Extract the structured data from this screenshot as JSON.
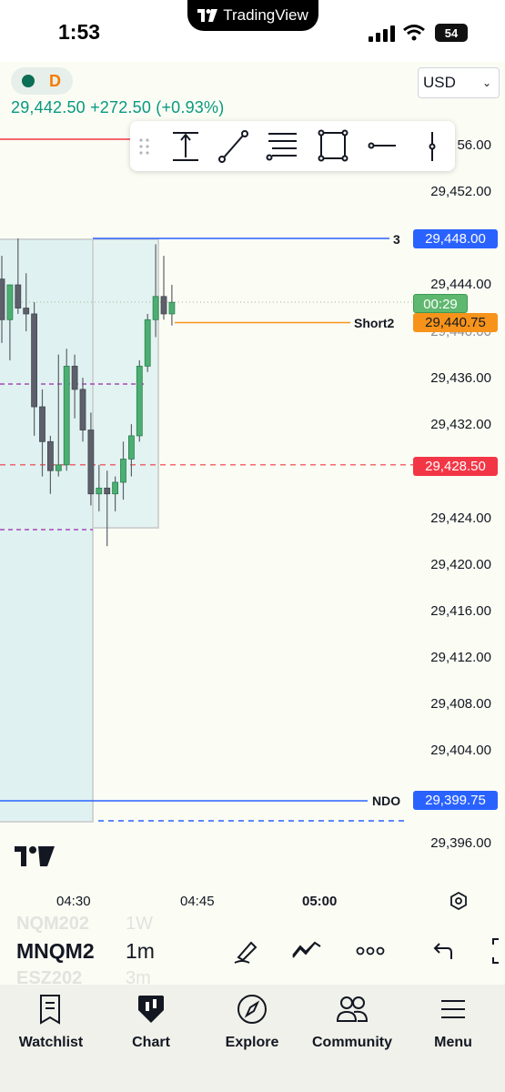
{
  "status": {
    "time": "1:53",
    "island_brand": "TradingView",
    "battery": "54"
  },
  "symbol": {
    "interval_badge": "D",
    "price_line": "29,442.50 +272.50 (+0.93%)"
  },
  "currency": "USD",
  "price_axis": [
    "56.00",
    "29,452.00",
    "29,448.00",
    "29,444.00",
    "29,440.00",
    "29,436.00",
    "29,432.00",
    "29,428.00",
    "29,424.00",
    "29,420.00",
    "29,416.00",
    "29,412.00",
    "29,408.00",
    "29,404.00",
    "29,400.00",
    "29,396.00"
  ],
  "tags": {
    "line3": {
      "label": "3",
      "price": "29,448.00",
      "color": "#2962ff"
    },
    "countdown": {
      "label": "00:29",
      "color": "#5fb86f"
    },
    "short2": {
      "label": "Short2",
      "price": "29,440.75",
      "color": "#f7931a"
    },
    "red": {
      "price": "29,428.50",
      "color": "#f23645"
    },
    "ndo": {
      "label": "NDO",
      "price": "29,399.75",
      "color": "#2962ff"
    }
  },
  "time_axis": [
    "04:30",
    "04:45",
    "05:00"
  ],
  "bottom": {
    "symbol_prev": "NQM202",
    "symbol": "MNQM2",
    "symbol_next": "ESZ202",
    "interval_prev": "1W",
    "interval": "1m",
    "interval_next": "3m"
  },
  "tabs": [
    "Watchlist",
    "Chart",
    "Explore",
    "Community",
    "Menu"
  ],
  "colors": {
    "up": "#4caf72",
    "down": "#5d606b",
    "green_text": "#089981"
  },
  "candles": [
    {
      "o": 29444.5,
      "h": 29446.5,
      "l": 29439.0,
      "c": 29441.0
    },
    {
      "o": 29441.0,
      "h": 29444.0,
      "l": 29437.5,
      "c": 29444.0
    },
    {
      "o": 29444.0,
      "h": 29448.0,
      "l": 29441.5,
      "c": 29442.0
    },
    {
      "o": 29442.0,
      "h": 29445.0,
      "l": 29440.0,
      "c": 29441.5
    },
    {
      "o": 29441.5,
      "h": 29442.5,
      "l": 29431.0,
      "c": 29433.5
    },
    {
      "o": 29433.5,
      "h": 29435.0,
      "l": 29427.5,
      "c": 29430.5
    },
    {
      "o": 29430.5,
      "h": 29431.0,
      "l": 29426.0,
      "c": 29428.0
    },
    {
      "o": 29428.0,
      "h": 29438.0,
      "l": 29427.5,
      "c": 29428.5
    },
    {
      "o": 29428.5,
      "h": 29438.5,
      "l": 29428.0,
      "c": 29437.0
    },
    {
      "o": 29437.0,
      "h": 29438.0,
      "l": 29432.5,
      "c": 29435.0
    },
    {
      "o": 29435.0,
      "h": 29436.0,
      "l": 29430.5,
      "c": 29431.5
    },
    {
      "o": 29431.5,
      "h": 29433.0,
      "l": 29425.0,
      "c": 29426.0
    },
    {
      "o": 29426.0,
      "h": 29428.5,
      "l": 29424.5,
      "c": 29426.5
    },
    {
      "o": 29426.5,
      "h": 29428.0,
      "l": 29421.5,
      "c": 29426.0
    },
    {
      "o": 29426.0,
      "h": 29427.5,
      "l": 29424.5,
      "c": 29427.0
    },
    {
      "o": 29427.0,
      "h": 29430.5,
      "l": 29425.5,
      "c": 29429.0
    },
    {
      "o": 29429.0,
      "h": 29432.0,
      "l": 29427.5,
      "c": 29431.0
    },
    {
      "o": 29431.0,
      "h": 29437.5,
      "l": 29430.5,
      "c": 29437.0
    },
    {
      "o": 29437.0,
      "h": 29441.5,
      "l": 29436.5,
      "c": 29441.0
    },
    {
      "o": 29441.0,
      "h": 29447.5,
      "l": 29439.5,
      "c": 29443.0
    },
    {
      "o": 29443.0,
      "h": 29446.5,
      "l": 29441.0,
      "c": 29441.5
    },
    {
      "o": 29441.5,
      "h": 29444.0,
      "l": 29440.5,
      "c": 29442.5
    }
  ]
}
